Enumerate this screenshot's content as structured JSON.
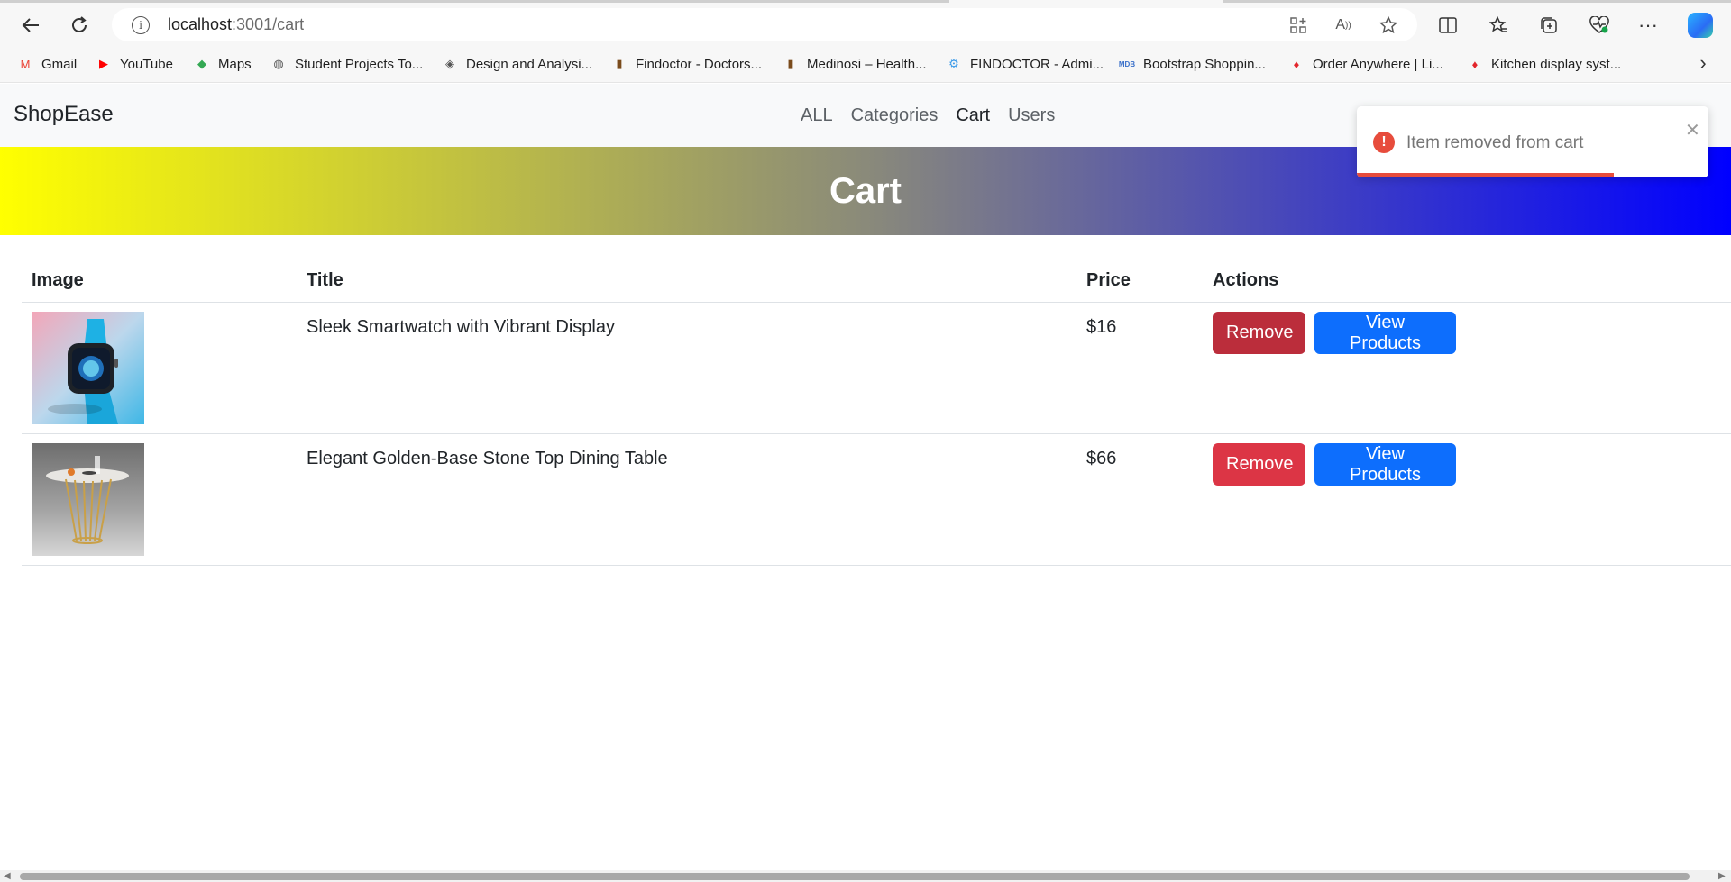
{
  "browser": {
    "url_host": "localhost",
    "url_rest": ":3001/cart",
    "bookmarks": [
      {
        "label": "Gmail",
        "icon": "gmail-icon",
        "color": "#ea4335",
        "glyph": "M"
      },
      {
        "label": "YouTube",
        "icon": "youtube-icon",
        "color": "#ff0000",
        "glyph": "▶"
      },
      {
        "label": "Maps",
        "icon": "maps-icon",
        "color": "#34a853",
        "glyph": "◆"
      },
      {
        "label": "Student Projects To...",
        "icon": "student-projects-icon",
        "color": "#555555",
        "glyph": "◍"
      },
      {
        "label": "Design and Analysi...",
        "icon": "design-analysis-icon",
        "color": "#555555",
        "glyph": "◈"
      },
      {
        "label": "Findoctor - Doctors...",
        "icon": "findoctor-icon",
        "color": "#7a4b1c",
        "glyph": "▮"
      },
      {
        "label": "Medinosi – Health...",
        "icon": "medinosi-icon",
        "color": "#7a4b1c",
        "glyph": "▮"
      },
      {
        "label": "FINDOCTOR - Admi...",
        "icon": "findoctor-admin-icon",
        "color": "#3d9be9",
        "glyph": "⚙"
      },
      {
        "label": "Bootstrap Shoppin...",
        "icon": "mdb-icon",
        "color": "#3b71ca",
        "glyph": "MDB"
      },
      {
        "label": "Order Anywhere | Li...",
        "icon": "flame-icon",
        "color": "#e3262c",
        "glyph": "♦"
      },
      {
        "label": "Kitchen display syst...",
        "icon": "flame-icon",
        "color": "#e3262c",
        "glyph": "♦"
      }
    ]
  },
  "app": {
    "brand": "ShopEase",
    "nav": [
      "ALL",
      "Categories",
      "Cart",
      "Users"
    ],
    "active_nav": "Cart",
    "page_title": "Cart"
  },
  "table": {
    "headers": {
      "image": "Image",
      "title": "Title",
      "price": "Price",
      "actions": "Actions"
    },
    "rows": [
      {
        "title": "Sleek Smartwatch with Vibrant Display",
        "price": "$16",
        "remove_label": "Remove",
        "view_label": "View Products",
        "remove_color": "#bb2d3b",
        "image": "smartwatch-image"
      },
      {
        "title": "Elegant Golden-Base Stone Top Dining Table",
        "price": "$66",
        "remove_label": "Remove",
        "view_label": "View Products",
        "remove_color": "#dc3545",
        "image": "dining-table-image"
      }
    ]
  },
  "toast": {
    "message": "Item removed from cart",
    "progress": 0.73,
    "color": "#e74c3c"
  },
  "colors": {
    "primary": "#0d6efd",
    "danger": "#dc3545",
    "hero_gradient": [
      "#ffff00",
      "#8a8a7a",
      "#0000ff"
    ]
  }
}
